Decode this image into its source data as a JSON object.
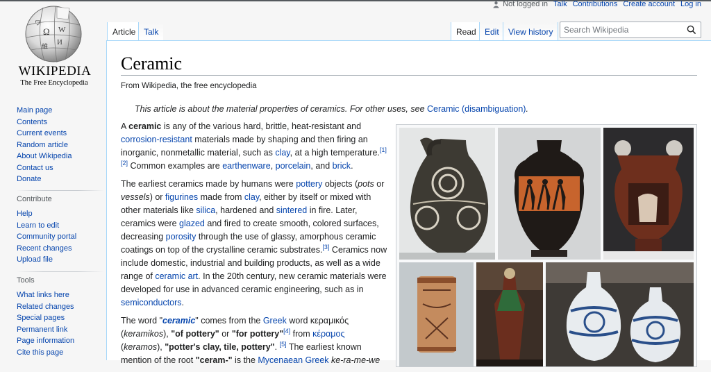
{
  "logo": {
    "wordmark": "WIKIPEDIA",
    "tagline": "The Free Encyclopedia"
  },
  "personal": {
    "not_logged_in": "Not logged in",
    "talk": "Talk",
    "contributions": "Contributions",
    "create_account": "Create account",
    "log_in": "Log in"
  },
  "tabs": {
    "article": "Article",
    "talk": "Talk",
    "read": "Read",
    "edit": "Edit",
    "view_history": "View history"
  },
  "search": {
    "placeholder": "Search Wikipedia"
  },
  "sidebar": {
    "nav": [
      "Main page",
      "Contents",
      "Current events",
      "Random article",
      "About Wikipedia",
      "Contact us",
      "Donate"
    ],
    "contribute_title": "Contribute",
    "contribute": [
      "Help",
      "Learn to edit",
      "Community portal",
      "Recent changes",
      "Upload file"
    ],
    "tools_title": "Tools",
    "tools": [
      "What links here",
      "Related changes",
      "Special pages",
      "Permanent link",
      "Page information",
      "Cite this page"
    ]
  },
  "article": {
    "title": "Ceramic",
    "from": "From Wikipedia, the free encyclopedia",
    "hatnote": {
      "text": "This article is about the material properties of ceramics. For other uses, see ",
      "link": "Ceramic (disambiguation)",
      "end": "."
    },
    "p1": {
      "a": "A ",
      "b": "ceramic",
      "c": " is any of the various hard, brittle, heat-resistant and ",
      "l1": "corrosion-resistant",
      "d": " materials made by shaping and then firing an inorganic, nonmetallic material, such as ",
      "l2": "clay",
      "e": ", at a high temperature.",
      "r1": "[1]",
      "r2": "[2]",
      "f": " Common examples are ",
      "l3": "earthenware",
      "g": ", ",
      "l4": "porcelain",
      "h": ", and ",
      "l5": "brick",
      "i": "."
    },
    "p2": {
      "a": "The earliest ceramics made by humans were ",
      "l1": "pottery",
      "b": " objects (",
      "i1": "pots",
      "c": " or ",
      "i2": "vessels",
      "d": ") or ",
      "l2": "figurines",
      "e": " made from ",
      "l3": "clay",
      "f": ", either by itself or mixed with other materials like ",
      "l4": "silica",
      "g": ", hardened and ",
      "l5": "sintered",
      "h": " in fire. Later, ceramics were ",
      "l6": "glazed",
      "i": " and fired to create smooth, colored surfaces, decreasing ",
      "l7": "porosity",
      "j": " through the use of glassy, amorphous ceramic coatings on top of the crystalline ceramic substrates.",
      "r3": "[3]",
      "k": " Ceramics now include domestic, industrial and building products, as well as a wide range of ",
      "l8": "ceramic art",
      "l": ". In the 20th century, new ceramic materials were developed for use in advanced ceramic engineering, such as in ",
      "l9": "semiconductors",
      "m": "."
    },
    "p3": {
      "a": "The word \"",
      "b": "ceramic",
      "c": "\" comes from the ",
      "l1": "Greek",
      "d": " word κεραμικός (",
      "i1": "keramikos",
      "e": "), ",
      "b2": "\"of pottery\"",
      "f": " or ",
      "b3": "\"for pottery\"",
      "r4": "[4]",
      "g": " from ",
      "l2": "κέραμος",
      "h": " (",
      "i2": "keramos",
      "j": "), ",
      "b4": "\"potter's clay, tile, pottery\"",
      "k": ". ",
      "r5": "[5]",
      "l": " The earliest known mention of the root ",
      "b5": "\"ceram-\"",
      "m": " is the ",
      "l3": "Mycenaean Greek",
      "n": " ",
      "i3": "ke-ra-me-we"
    }
  }
}
